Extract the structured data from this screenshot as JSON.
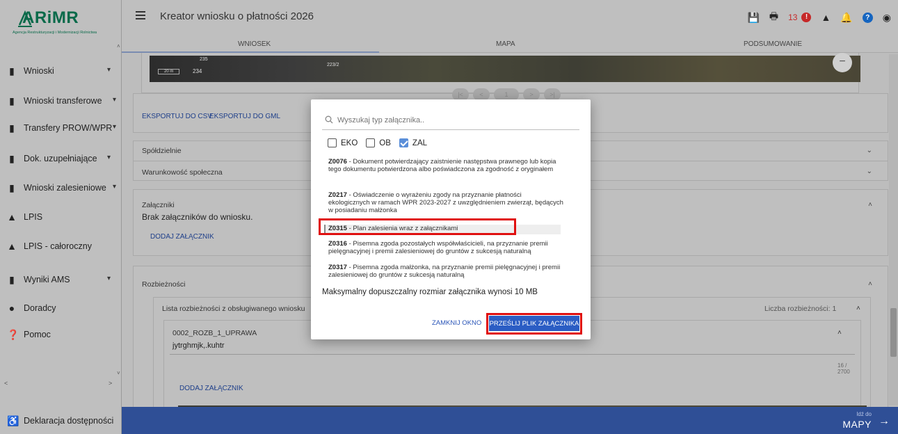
{
  "app": {
    "logo_text": "ARiMR",
    "logo_subtitle": "Agencja Restrukturyzacji i Modernizacji Rolnictwa",
    "title": "Kreator wniosku o płatności 2026",
    "notification_count": "13"
  },
  "tabs": [
    {
      "label": "WNIOSEK"
    },
    {
      "label": "MAPA"
    },
    {
      "label": "PODSUMOWANIE"
    }
  ],
  "sidebar": {
    "items": [
      {
        "label": "Wnioski",
        "icon": "clipboard-icon",
        "expandable": true
      },
      {
        "label": "Wnioski transferowe",
        "icon": "clipboard-icon",
        "expandable": true
      },
      {
        "label": "Transfery PROW/WPR",
        "icon": "clipboard-icon",
        "expandable": true
      },
      {
        "label": "Dok. uzupełniające",
        "icon": "clipboard-icon",
        "expandable": true
      },
      {
        "label": "Wnioski zalesieniowe",
        "icon": "clipboard-icon",
        "expandable": true
      },
      {
        "label": "LPIS",
        "icon": "mountain-icon",
        "expandable": false
      },
      {
        "label": "LPIS - całoroczny",
        "icon": "mountain-icon",
        "expandable": false
      },
      {
        "label": "Wyniki AMS",
        "icon": "clipboard-icon",
        "expandable": true
      },
      {
        "label": "Doradcy",
        "icon": "person-icon",
        "expandable": false
      },
      {
        "label": "Pomoc",
        "icon": "help-icon",
        "expandable": false
      }
    ],
    "footer": {
      "label": "Deklaracja dostępności",
      "icon": "accessibility-icon"
    }
  },
  "main": {
    "map_labels": [
      "235",
      "234",
      "223/2",
      "20 m"
    ],
    "export_csv": "EKSPORTUJ DO CSV",
    "export_gml": "EKSPORTUJ DO GML",
    "pager": [
      "|<",
      "<",
      "1",
      ">",
      ">|"
    ],
    "sections": {
      "spoldzielnie": "Spółdzielnie",
      "warunkowosc": "Warunkowość społeczna",
      "zalaczniki_title": "Załączniki",
      "zalaczniki_empty": "Brak załączników do wniosku.",
      "dodaj_zalacznik": "DODAJ ZAŁĄCZNIK",
      "rozbieznosci": "Rozbieżności",
      "lista_rozbieznosci": "Lista rozbieżności z obsługiwanego wniosku",
      "liczba_rozbieznosci": "Liczba rozbieżności: 1",
      "rozb_code": "0002_ROZB_1_UPRAWA",
      "rozb_text": "jytrghmjk,.kuhtr",
      "char_counter": "16 / 2700",
      "dodaj_zalacznik_2": "DODAJ ZAŁĄCZNIK"
    }
  },
  "bottom_bar": {
    "small": "Idź do",
    "big": "MAPY"
  },
  "modal": {
    "search_placeholder": "Wyszukaj typ załącznika..",
    "filters": [
      {
        "label": "EKO",
        "checked": false
      },
      {
        "label": "OB",
        "checked": false
      },
      {
        "label": "ZAL",
        "checked": true
      }
    ],
    "items": [
      {
        "code": "Z0076",
        "text": " - Dokument potwierdzający zaistnienie następstwa prawnego lub kopia tego dokumentu potwierdzona albo poświadczona za zgodność z oryginałem"
      },
      {
        "code": "Z0217",
        "text": " - Oświadczenie o wyrażeniu zgody na przyznanie płatności ekologicznych w ramach WPR 2023-2027 z uwzględnieniem zwierząt, będących w posiadaniu małżonka"
      },
      {
        "code": "Z0315",
        "text": " - Plan zalesienia wraz z załącznikami",
        "selected": true
      },
      {
        "code": "Z0316",
        "text": " - Pisemna zgoda pozostałych współwłaścicieli, na przyznanie premii pielęgnacyjnej i premii zalesieniowej do gruntów z sukcesją naturalną"
      },
      {
        "code": "Z0317",
        "text": " - Pisemna zgoda małżonka, na przyznanie premii pielęgnacyjnej i premii zalesieniowej do gruntów z sukcesją naturalną"
      }
    ],
    "max_size": "Maksymalny dopuszczalny rozmiar załącznika wynosi 10 MB",
    "close_label": "ZAMKNIJ OKNO",
    "send_label": "PRZEŚLIJ PLIK ZAŁĄCZNIKA"
  },
  "colors": {
    "brand_green": "#0a6a4a",
    "primary_blue": "#2b5dc4",
    "highlight_red": "#e01010",
    "bottom_bar": "#2f4f96"
  }
}
